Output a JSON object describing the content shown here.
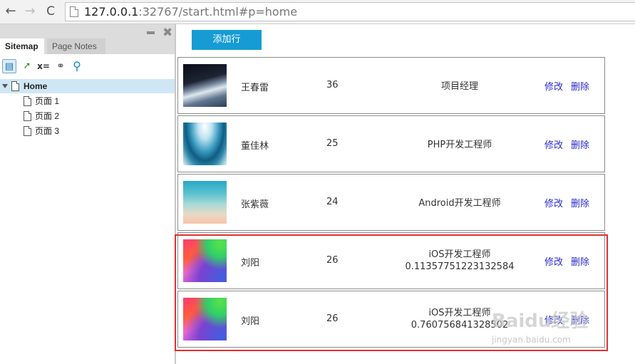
{
  "browser": {
    "url_host": "127.0.0.1",
    "url_rest": ":32767/start.html#p=home",
    "back_icon": "←",
    "forward_icon": "→",
    "reload_icon": "C",
    "close_icon": "✖"
  },
  "left_panel": {
    "tabs": [
      {
        "label": "Sitemap"
      },
      {
        "label": "Page Notes"
      }
    ],
    "tools": {
      "t1": "▤",
      "t2": "➚",
      "t3": "x=",
      "t4": "⚭",
      "t5": "⚲"
    },
    "tree": {
      "home": "Home",
      "children": [
        {
          "label": "页面 1"
        },
        {
          "label": "页面 2"
        },
        {
          "label": "页面 3"
        }
      ]
    }
  },
  "main": {
    "add_button": "添加行",
    "rows": [
      {
        "name": "王春雷",
        "age": "36",
        "job": "项目经理",
        "job_line2": "",
        "edit": "修改",
        "delete": "删除"
      },
      {
        "name": "董佳林",
        "age": "25",
        "job": "PHP开发工程师",
        "job_line2": "",
        "edit": "修改",
        "delete": "删除"
      },
      {
        "name": "张紫薇",
        "age": "24",
        "job": "Android开发工程师",
        "job_line2": "",
        "edit": "修改",
        "delete": "删除"
      },
      {
        "name": "刘阳",
        "age": "26",
        "job": "iOS开发工程师",
        "job_line2": "0.11357751223132584",
        "edit": "修改",
        "delete": "删除"
      },
      {
        "name": "刘阳",
        "age": "26",
        "job": "iOS开发工程师",
        "job_line2": "0.760756841328502",
        "edit": "修改",
        "delete": "删除"
      }
    ]
  },
  "watermark": {
    "text": "Baidu经验",
    "sub": "jingyan.baidu.com"
  },
  "colors": {
    "accent": "#169bd5",
    "highlight": "#e03030",
    "link": "#2a2ad0"
  }
}
